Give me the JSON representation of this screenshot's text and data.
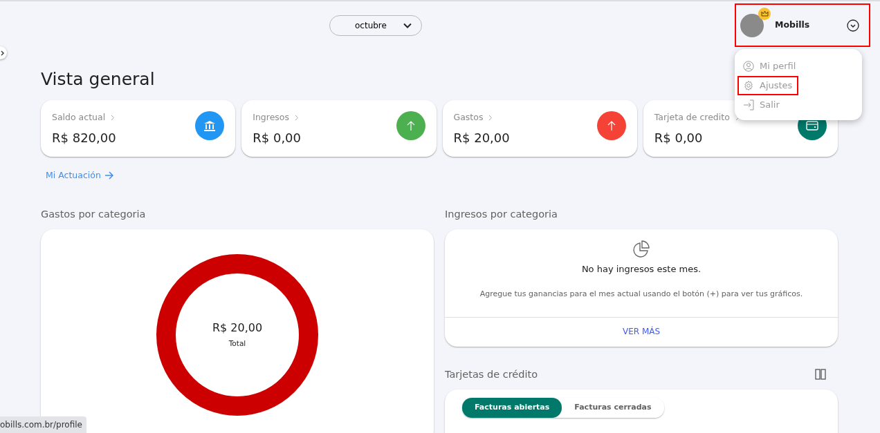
{
  "month_selector": {
    "value": "octubre"
  },
  "profile": {
    "name": "Mobills",
    "premium": true,
    "highlighted": true
  },
  "profile_menu": {
    "items": [
      {
        "label": "Mi perfil",
        "kind": "profile",
        "highlighted": false
      },
      {
        "label": "Ajustes",
        "kind": "settings",
        "highlighted": true
      },
      {
        "label": "Salir",
        "kind": "logout",
        "highlighted": false
      }
    ]
  },
  "title": "Vista general",
  "summary_cards": [
    {
      "label": "Saldo actual",
      "value": "R$ 820,00",
      "kind": "bank",
      "color": "#2196f3"
    },
    {
      "label": "Ingresos",
      "value": "R$ 0,00",
      "kind": "up",
      "color": "#4caf50"
    },
    {
      "label": "Gastos",
      "value": "R$ 20,00",
      "kind": "up",
      "color": "#f44336"
    },
    {
      "label": "Tarjeta de credito",
      "value": "R$ 0,00",
      "kind": "card",
      "color": "#00796b"
    }
  ],
  "performance_link": "Mi Actuación",
  "expenses_by_category": {
    "title": "Gastos por categoria",
    "total": "R$ 20,00",
    "total_label": "Total",
    "segments": [
      {
        "color": "#cc0000"
      }
    ]
  },
  "income_by_category": {
    "title": "Ingresos por categoria",
    "empty_title": "No hay ingresos este mes.",
    "empty_text": "Agregue tus ganancias para el mes actual usando el botón (+) para ver tus gráficos.",
    "button": "VER MÁS"
  },
  "credit_cards": {
    "title": "Tarjetas de crédito",
    "tabs": [
      {
        "label": "Facturas abiertas",
        "selected": true
      },
      {
        "label": "Facturas cerradas",
        "selected": false
      }
    ]
  },
  "status_bar": {
    "url": "obills.com.br/profile"
  }
}
